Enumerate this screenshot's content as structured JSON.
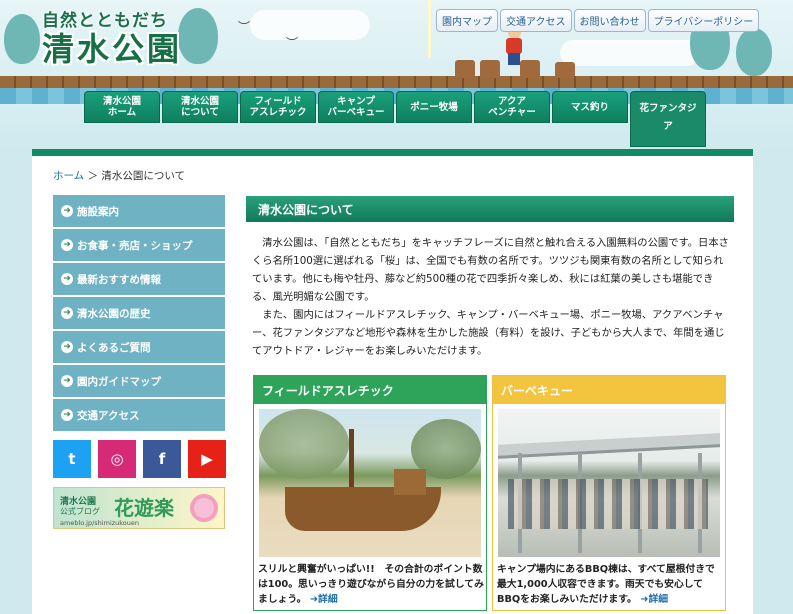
{
  "header": {
    "logo_sub": "自然とともだち",
    "logo_main": "清水公園",
    "util_links": [
      "園内マップ",
      "交通アクセス",
      "お問い合わせ",
      "プライバシーポリシー"
    ]
  },
  "nav": {
    "tabs": [
      {
        "label": "清水公園\nホーム"
      },
      {
        "label": "清水公園\nについて"
      },
      {
        "label": "フィールド\nアスレチック"
      },
      {
        "label": "キャンプ\nバーベキュー"
      },
      {
        "label": "ポニー牧場"
      },
      {
        "label": "アクア\nベンチャー"
      },
      {
        "label": "マス釣り"
      },
      {
        "label": "花ファンタジ\nア",
        "active": true
      }
    ]
  },
  "breadcrumb": {
    "home": "ホーム",
    "sep": "＞",
    "current": "清水公園について"
  },
  "sidebar": {
    "items": [
      {
        "label": "施設案内"
      },
      {
        "label": "お食事・売店・ショップ"
      },
      {
        "label": "最新おすすめ情報"
      },
      {
        "label": "清水公園の歴史"
      },
      {
        "label": "よくあるご質問"
      },
      {
        "label": "園内ガイドマップ"
      },
      {
        "label": "交通アクセス"
      }
    ],
    "arrow": "➜"
  },
  "social": {
    "icons": [
      "twitter-icon",
      "instagram-icon",
      "facebook-icon",
      "youtube-icon"
    ],
    "glyphs": [
      "t",
      "◎",
      "f",
      "▶"
    ]
  },
  "blog": {
    "line1": "清水公園",
    "line2": "公式ブログ",
    "title": "花遊楽",
    "url": "ameblo.jp/shimizukouen"
  },
  "main": {
    "heading": "清水公園について",
    "paragraphs": [
      "清水公園は、「自然とともだち」をキャッチフレーズに自然と触れ合える入園無料の公園です。日本さくら名所100選に選ばれる「桜」は、全国でも有数の名所です。ツツジも関東有数の名所として知られています。他にも梅や牡丹、藤など約500種の花で四季折々楽しめ、秋には紅葉の美しさも堪能できる、風光明媚な公園です。",
      "また、園内にはフィールドアスレチック、キャンプ・バーベキュー場、ポニー牧場、アクアベンチャー、花ファンタジアなど地形や森林を生かした施設（有料）を設け、子どもから大人まで、年間を通じてアウトドア・レジャーをお楽しみいただけます。"
    ],
    "cards": [
      {
        "title": "フィールドアスレチック",
        "caption": "スリルと興奮がいっぱい!!　その合計のポイント数は100。思いっきり遊びながら自分の力を試してみましょう。",
        "more": "➜詳細"
      },
      {
        "title": "バーベキュー",
        "caption": "キャンプ場内にあるBBQ棟は、すべて屋根付きで最大1,000人収容できます。雨天でも安心してBBQをお楽しみいただけます。",
        "more": "➜詳細"
      }
    ]
  }
}
